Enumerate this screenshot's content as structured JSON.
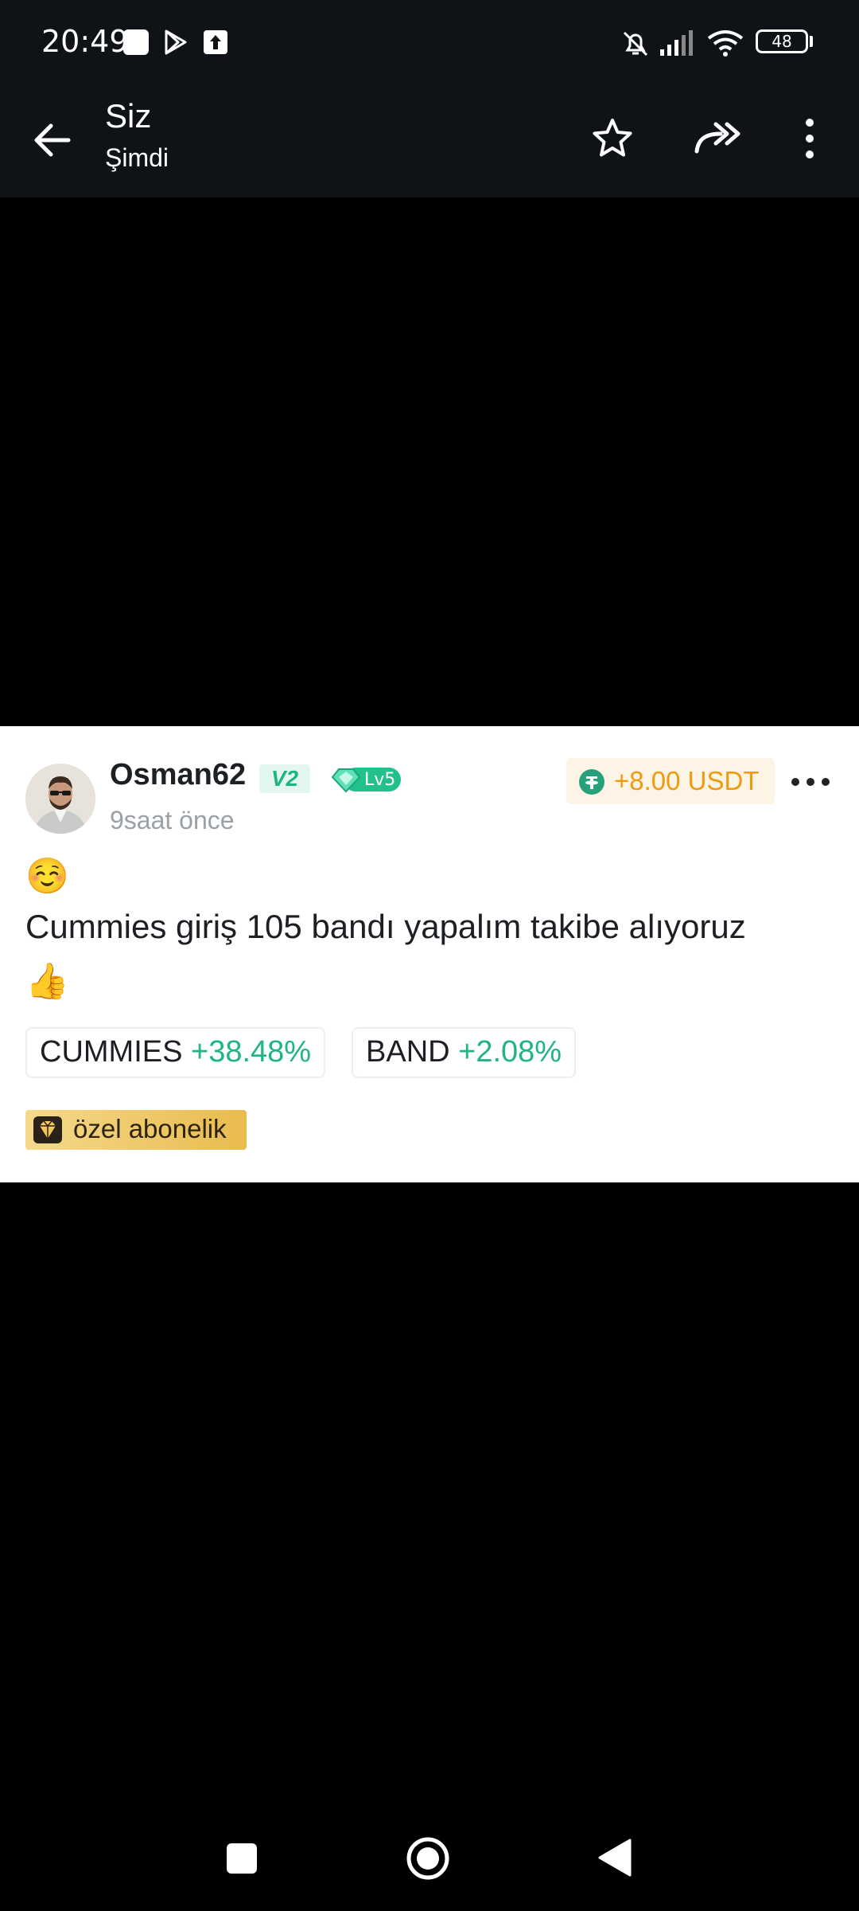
{
  "status_bar": {
    "time": "20:49",
    "battery": "48",
    "icons": [
      "app-square-icon",
      "play-store-icon",
      "upload-icon",
      "mute-bell-icon",
      "signal-icon",
      "wifi-icon",
      "battery-icon"
    ]
  },
  "app_bar": {
    "title": "Siz",
    "subtitle": "Şimdi",
    "icons": [
      "back-arrow-icon",
      "star-icon",
      "share-forward-icon",
      "more-vertical-icon"
    ]
  },
  "post": {
    "username": "Osman62",
    "vip_badge": "V2",
    "level_badge": "Lv5",
    "time": "9saat önce",
    "reward": "+8.00 USDT",
    "emoji_top": "☺️",
    "text": "Cummies giriş 105 bandı yapalım takibe alıyoruz",
    "emoji_bottom": "👍",
    "tags": [
      {
        "name": "CUMMIES",
        "change": "+38.48%"
      },
      {
        "name": "BAND",
        "change": "+2.08%"
      }
    ],
    "subscription_label": "özel abonelik",
    "colors": {
      "positive": "#1fb583",
      "reward": "#ef9a10",
      "gold": "#e9bb4d"
    }
  },
  "nav_bar": {
    "icons": [
      "recents-square-icon",
      "home-circle-icon",
      "back-triangle-icon"
    ]
  }
}
